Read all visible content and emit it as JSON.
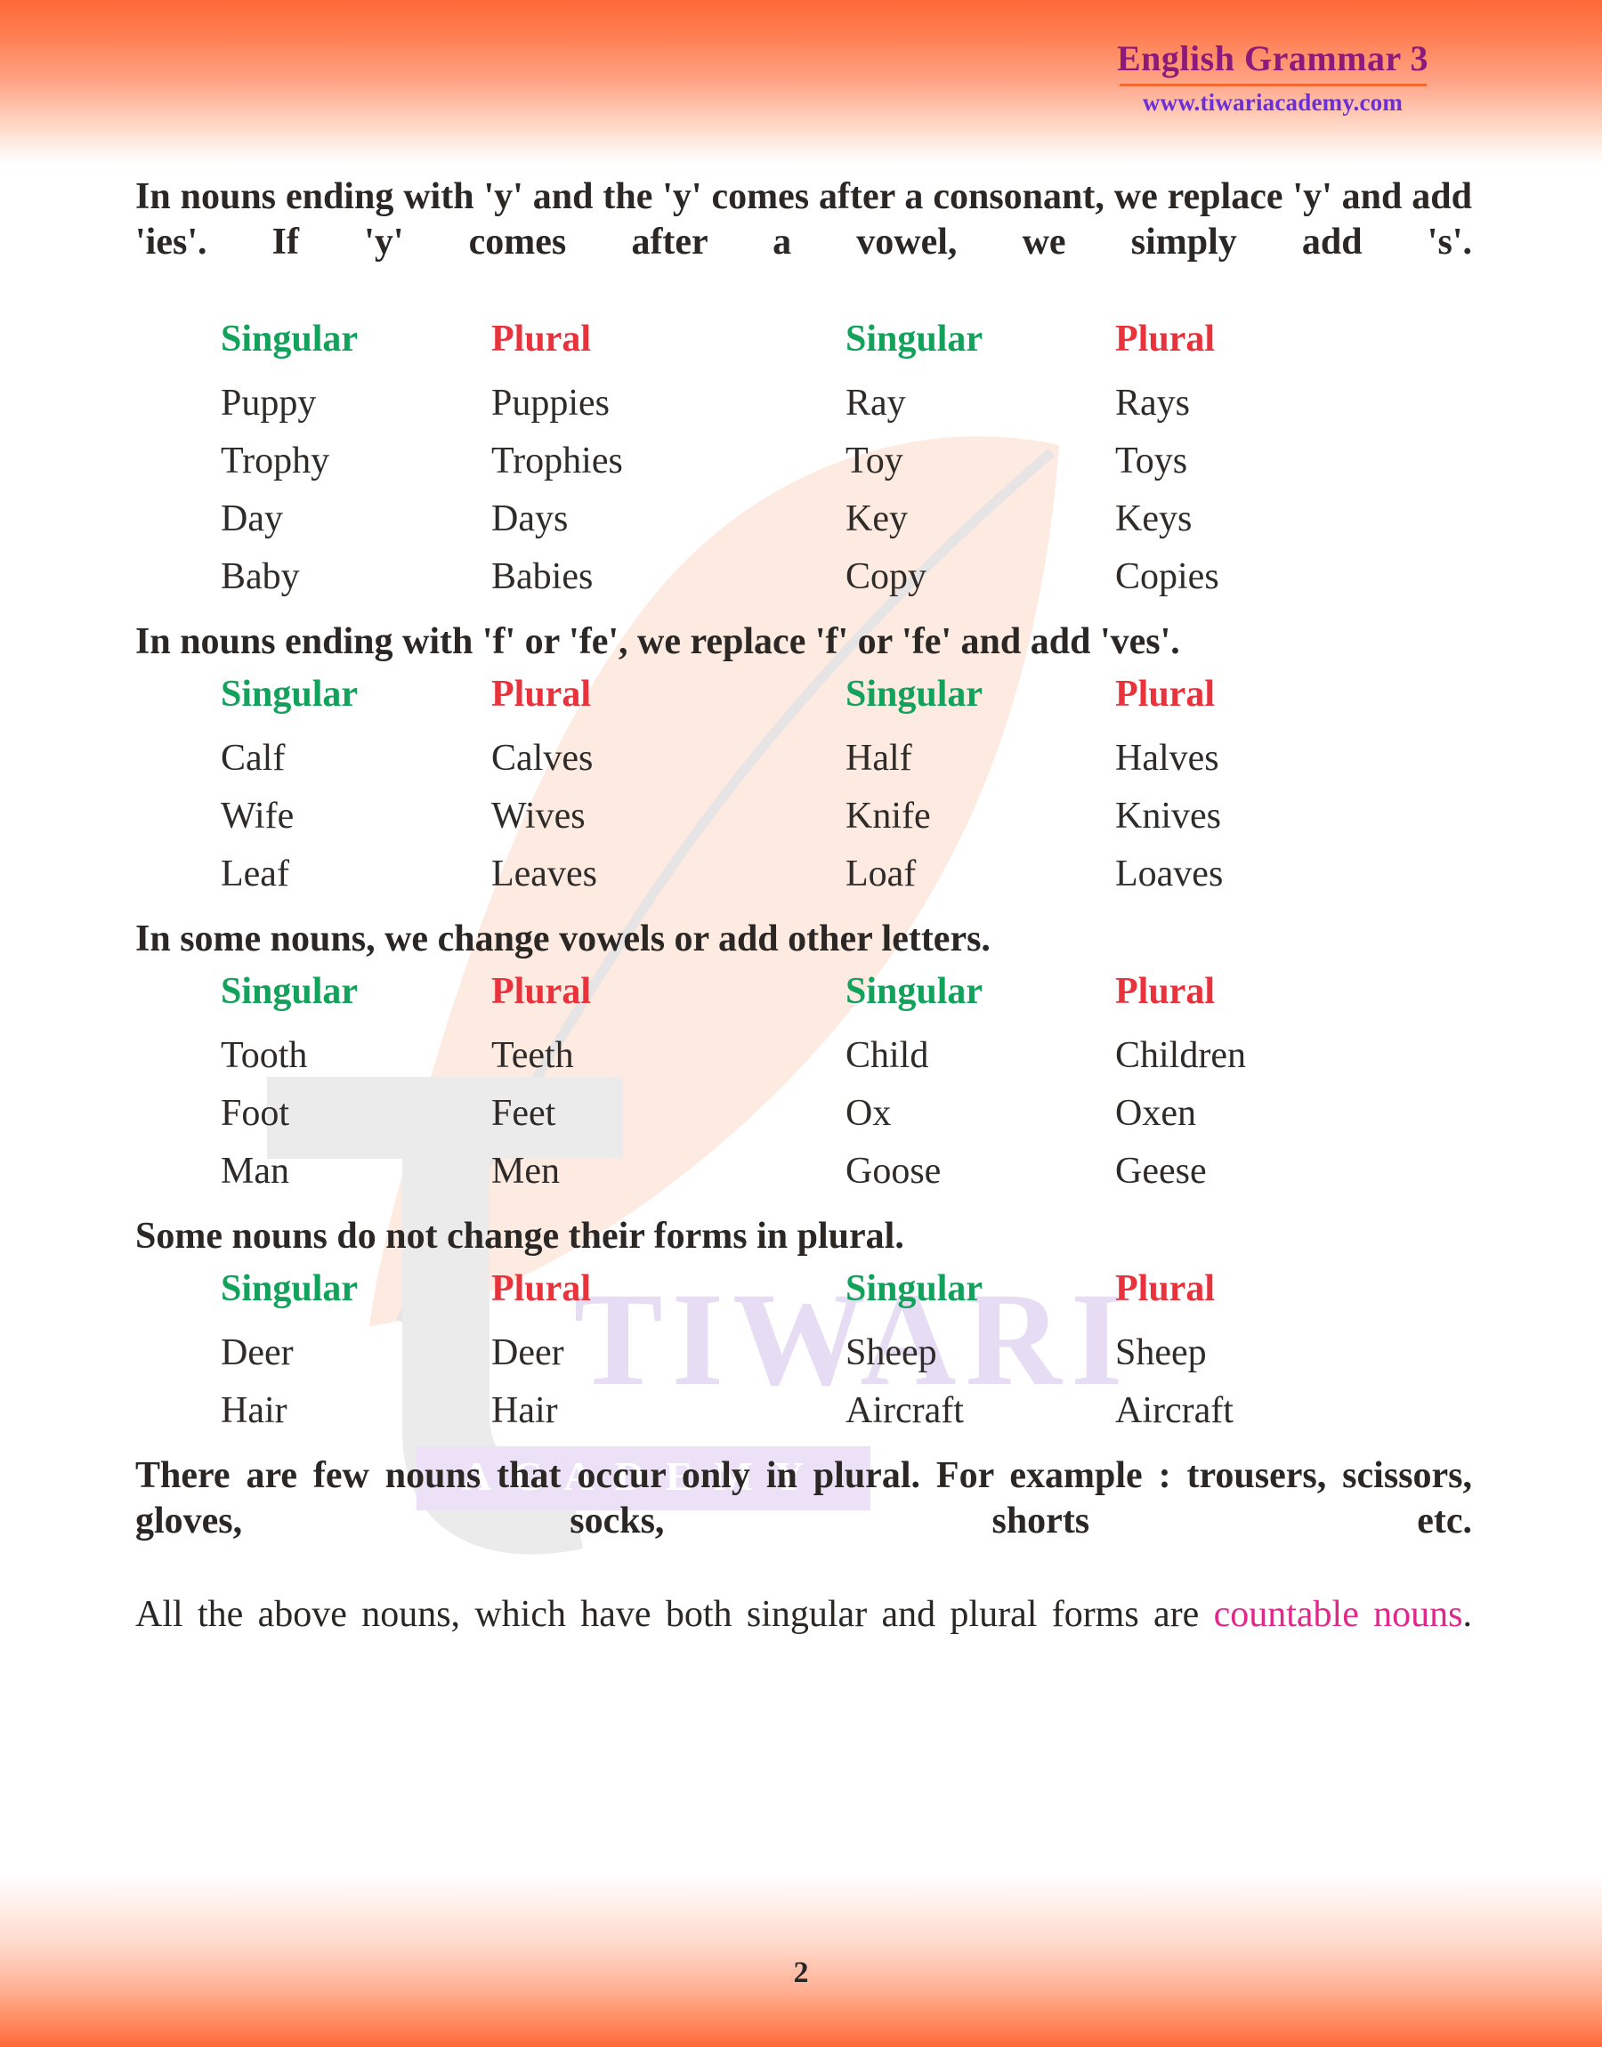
{
  "header": {
    "title": "English Grammar 3",
    "url": "www.tiwariacademy.com"
  },
  "watermark": {
    "brand": "TIWARI",
    "sub": "ACADEMY"
  },
  "colors": {
    "singular": "#13a25b",
    "plural": "#e8333d",
    "accent_orange": "#ff6838",
    "title_purple": "#8b1a7a",
    "url_purple": "#6b2fd6",
    "pink": "#e0278a",
    "body_text": "#2b2725"
  },
  "intro": {
    "line1": "In nouns ending with 'y' and the 'y' comes after a consonant, we",
    "line2": "replace 'y' and add 'ies'. If 'y' comes after a vowel, we simply add 's'."
  },
  "table_headers": {
    "singular": "Singular",
    "plural": "Plural"
  },
  "sections": [
    {
      "heading": "In nouns ending with 'y' and the 'y' comes after a consonant, we replace 'y' and add 'ies'. If 'y' comes after a vowel, we simply add 's'.",
      "rows": [
        [
          "Puppy",
          "Puppies",
          "Ray",
          "Rays"
        ],
        [
          "Trophy",
          "Trophies",
          "Toy",
          "Toys"
        ],
        [
          "Day",
          "Days",
          "Key",
          "Keys"
        ],
        [
          "Baby",
          "Babies",
          "Copy",
          "Copies"
        ]
      ]
    },
    {
      "heading": "In nouns ending with 'f' or 'fe', we replace 'f' or 'fe' and add 'ves'.",
      "rows": [
        [
          "Calf",
          "Calves",
          "Half",
          "Halves"
        ],
        [
          "Wife",
          "Wives",
          "Knife",
          "Knives"
        ],
        [
          "Leaf",
          "Leaves",
          "Loaf",
          "Loaves"
        ]
      ]
    },
    {
      "heading": "In some nouns, we change vowels or add other letters.",
      "rows": [
        [
          "Tooth",
          "Teeth",
          "Child",
          "Children"
        ],
        [
          "Foot",
          "Feet",
          "Ox",
          "Oxen"
        ],
        [
          "Man",
          "Men",
          "Goose",
          "Geese"
        ]
      ]
    },
    {
      "heading": "Some nouns do not change their forms in plural.",
      "rows": [
        [
          "Deer",
          "Deer",
          "Sheep",
          "Sheep"
        ],
        [
          "Hair",
          "Hair",
          "Aircraft",
          "Aircraft"
        ]
      ]
    }
  ],
  "closing": {
    "plural_only_line1": "There are few nouns that occur only in plural. For example :",
    "plural_only_line2": "trousers, scissors, gloves, socks, shorts etc.",
    "countable_lead": "All the above nouns, which have both singular and plural forms are ",
    "countable_term": "countable nouns",
    "countable_period": "."
  },
  "footer": {
    "page_number": "2"
  }
}
